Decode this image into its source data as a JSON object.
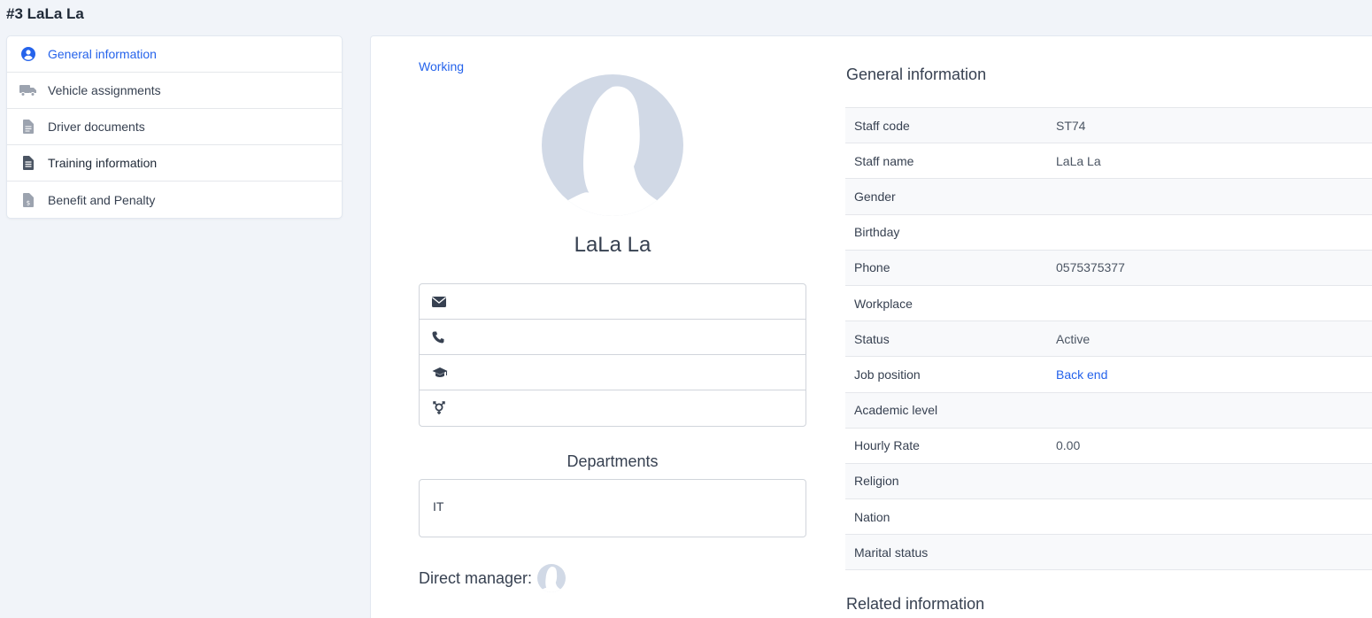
{
  "page": {
    "title": "#3 LaLa La"
  },
  "sidebar": {
    "items": [
      {
        "label": "General information",
        "icon": "user-circle-icon"
      },
      {
        "label": "Vehicle assignments",
        "icon": "truck-icon"
      },
      {
        "label": "Driver documents",
        "icon": "document-icon"
      },
      {
        "label": "Training information",
        "icon": "document-list-icon"
      },
      {
        "label": "Benefit and Penalty",
        "icon": "document-dollar-icon"
      }
    ]
  },
  "profile": {
    "status": "Working",
    "name": "LaLa La",
    "contact": {
      "email": "",
      "phone": "",
      "education": "",
      "gender": ""
    },
    "departments_title": "Departments",
    "departments": [
      "IT"
    ],
    "direct_manager_label": "Direct manager:"
  },
  "general_info": {
    "title": "General information",
    "rows": [
      {
        "label": "Staff code",
        "value": "ST74"
      },
      {
        "label": "Staff name",
        "value": "LaLa La"
      },
      {
        "label": "Gender",
        "value": ""
      },
      {
        "label": "Birthday",
        "value": ""
      },
      {
        "label": "Phone",
        "value": "0575375377"
      },
      {
        "label": "Workplace",
        "value": ""
      },
      {
        "label": "Status",
        "value": "Active"
      },
      {
        "label": "Job position",
        "value": "Back end"
      },
      {
        "label": "Academic level",
        "value": ""
      },
      {
        "label": "Hourly Rate",
        "value": "0.00"
      },
      {
        "label": "Religion",
        "value": ""
      },
      {
        "label": "Nation",
        "value": ""
      },
      {
        "label": "Marital status",
        "value": ""
      }
    ]
  },
  "related_info": {
    "title": "Related information"
  },
  "colors": {
    "accent": "#2563eb",
    "avatar_bg": "#d1d9e6",
    "page_bg": "#f1f4f9"
  }
}
